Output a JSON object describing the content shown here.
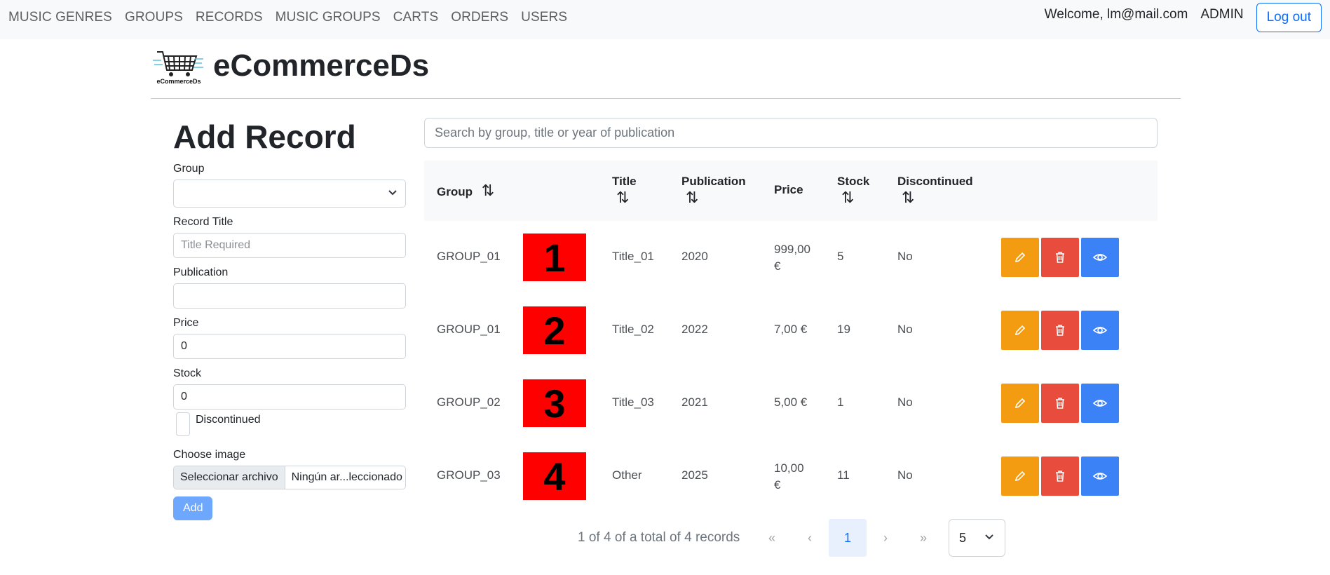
{
  "nav": {
    "items": [
      "MUSIC GENRES",
      "GROUPS",
      "RECORDS",
      "MUSIC GROUPS",
      "CARTS",
      "ORDERS",
      "USERS"
    ],
    "welcome": "Welcome, lm@mail.com",
    "role": "ADMIN",
    "logout": "Log out"
  },
  "brand": {
    "name": "eCommerceDs",
    "logo_caption": "eCommerceDs"
  },
  "form": {
    "title": "Add Record",
    "group_label": "Group",
    "group_value": "",
    "title_label": "Record Title",
    "title_placeholder": "Title Required",
    "publication_label": "Publication",
    "publication_value": "",
    "price_label": "Price",
    "price_value": "0",
    "stock_label": "Stock",
    "stock_value": "0",
    "discontinued_label": "Discontinued",
    "image_label": "Choose image",
    "file_button": "Seleccionar archivo",
    "file_name": "Ningún ar...leccionado",
    "add_button": "Add"
  },
  "search": {
    "placeholder": "Search by group, title or year of publication"
  },
  "table": {
    "headers": {
      "group": "Group",
      "title": "Title",
      "publication": "Publication",
      "price": "Price",
      "stock": "Stock",
      "discontinued": "Discontinued",
      "sort_glyph": "⇅"
    },
    "rows": [
      {
        "group": "GROUP_01",
        "image": "1",
        "title": "Title_01",
        "publication": "2020",
        "price_line1": "999,00",
        "price_line2": "€",
        "stock": "5",
        "discontinued": "No"
      },
      {
        "group": "GROUP_01",
        "image": "2",
        "title": "Title_02",
        "publication": "2022",
        "price_line1": "7,00 €",
        "price_line2": "",
        "stock": "19",
        "discontinued": "No"
      },
      {
        "group": "GROUP_02",
        "image": "3",
        "title": "Title_03",
        "publication": "2021",
        "price_line1": "5,00 €",
        "price_line2": "",
        "stock": "1",
        "discontinued": "No"
      },
      {
        "group": "GROUP_03",
        "image": "4",
        "title": "Other",
        "publication": "2025",
        "price_line1": "10,00",
        "price_line2": "€",
        "stock": "11",
        "discontinued": "No"
      }
    ],
    "icons": {
      "edit": "pencil-icon",
      "delete": "trash-icon",
      "view": "eye-icon"
    },
    "colors": {
      "edit": "#f39c12",
      "delete": "#e74c3c",
      "view": "#3b82f6",
      "image_bg": "#ff0000"
    }
  },
  "pagination": {
    "info": "1 of 4 of a total of 4 records",
    "first": "«",
    "prev": "‹",
    "current": "1",
    "next": "›",
    "last": "»",
    "page_size": "5"
  }
}
